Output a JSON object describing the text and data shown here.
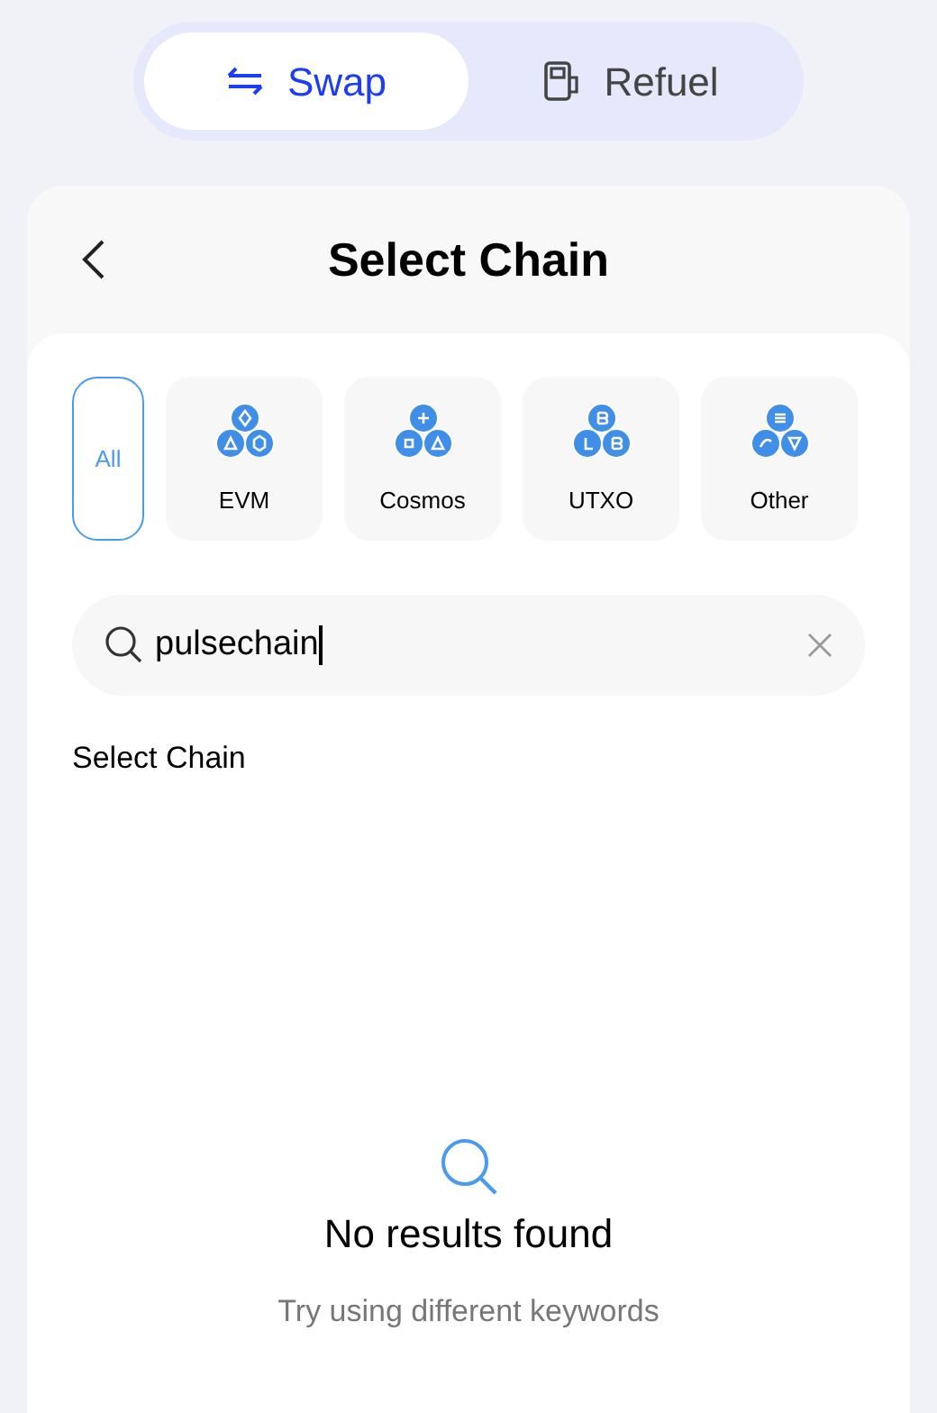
{
  "mode_tabs": [
    {
      "label": "Swap",
      "kind": "swap",
      "selected": true
    },
    {
      "label": "Refuel",
      "kind": "fuel",
      "selected": false
    }
  ],
  "header": {
    "title": "Select Chain"
  },
  "filters": [
    {
      "label": "All",
      "kind": "text",
      "selected": true
    },
    {
      "label": "EVM",
      "kind": "icons",
      "selected": false
    },
    {
      "label": "Cosmos",
      "kind": "icons",
      "selected": false
    },
    {
      "label": "UTXO",
      "kind": "icons",
      "selected": false
    },
    {
      "label": "Other",
      "kind": "icons",
      "selected": false
    }
  ],
  "search": {
    "value": "pulsechain"
  },
  "section_title": "Select Chain",
  "empty_state": {
    "title": "No results found",
    "message": "Try using different keywords"
  }
}
